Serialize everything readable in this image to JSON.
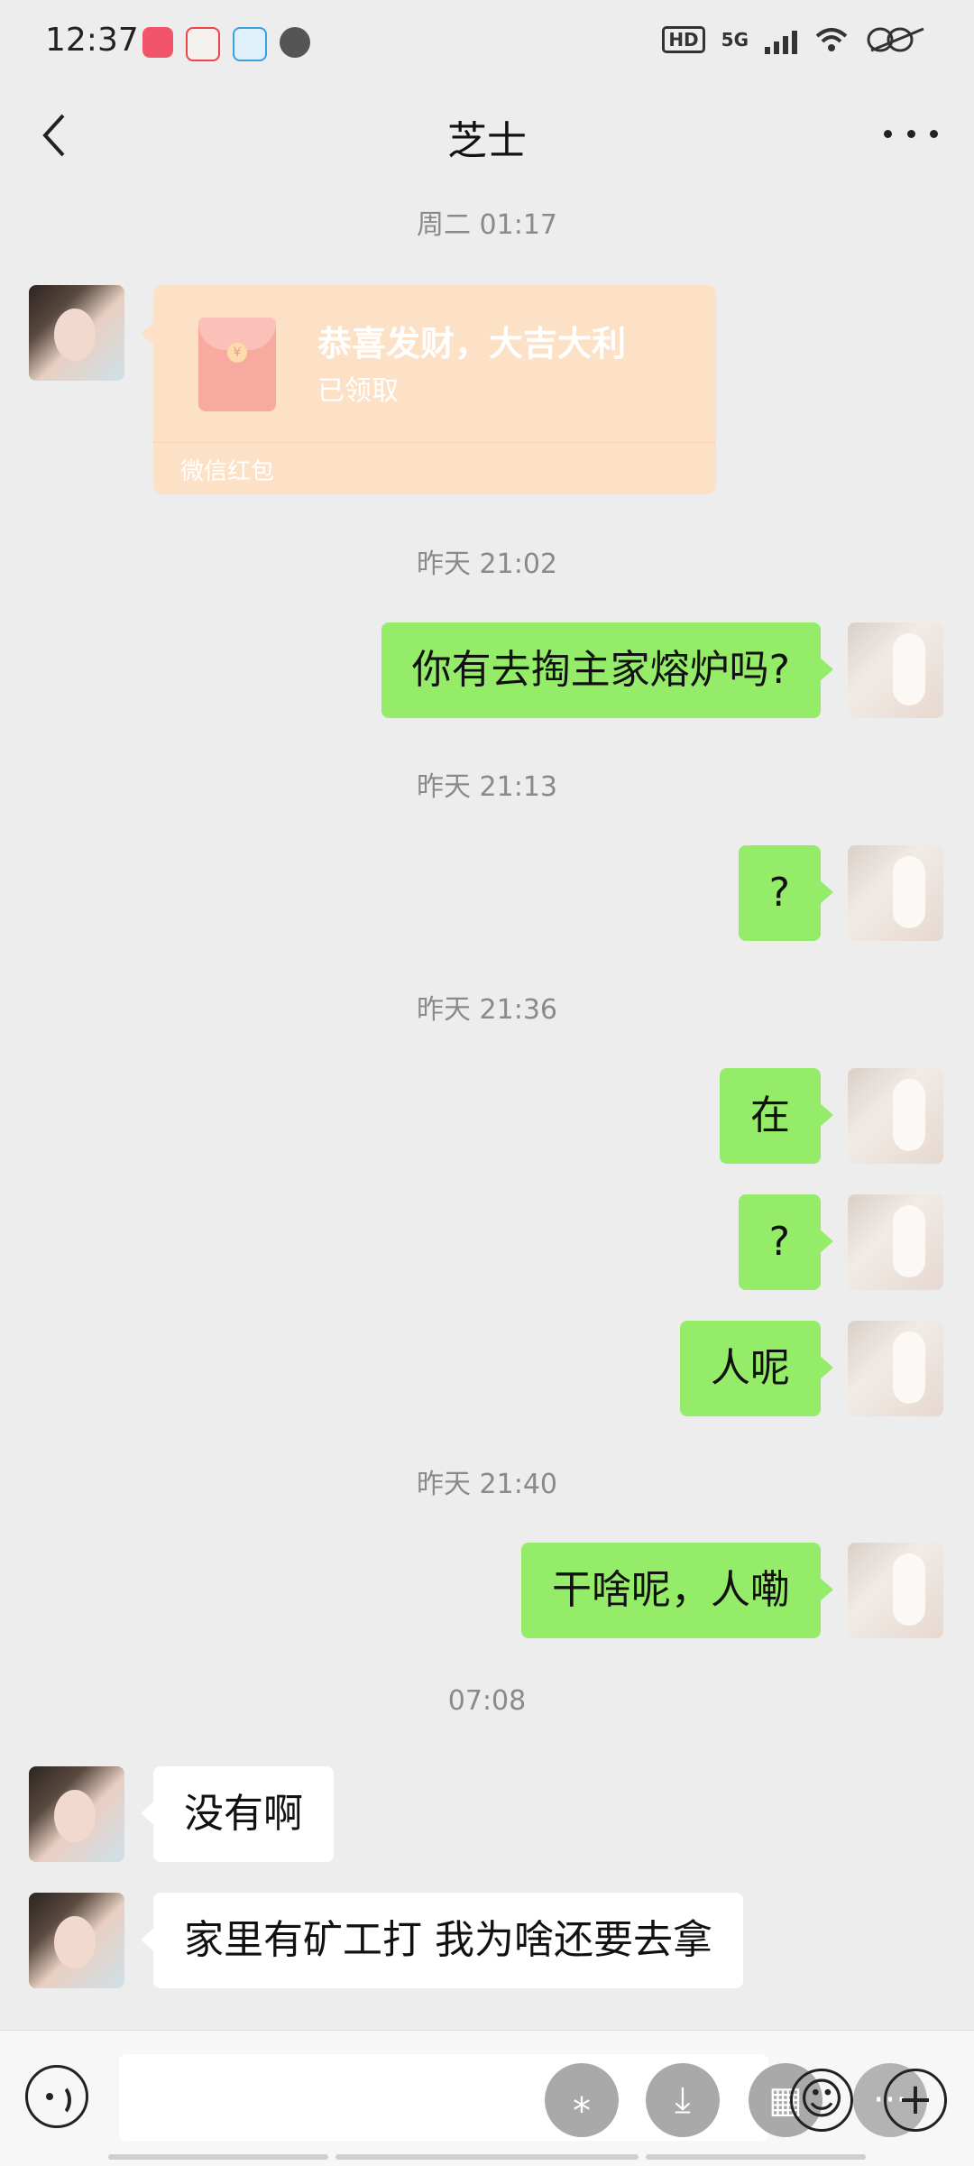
{
  "status_bar": {
    "time": "12:37",
    "network": "5G",
    "hd": "HD"
  },
  "header": {
    "title": "芝士"
  },
  "red_packet": {
    "title": "恭喜发财，大吉大利",
    "status": "已领取",
    "footer": "微信红包",
    "coin": "¥"
  },
  "messages": {
    "ts1": "周二 01:17",
    "ts2": "昨天 21:02",
    "m1": "你有去掏主家熔炉吗?",
    "ts3": "昨天 21:13",
    "m2": "?",
    "ts4": "昨天 21:36",
    "m3": "在",
    "m4": "?",
    "m5": "人呢",
    "ts5": "昨天 21:40",
    "m6": "干啥呢，人嘞",
    "ts6": "07:08",
    "r1": "没有啊",
    "r2": "家里有矿工打 我为啥还要去拿"
  },
  "input_bar": {
    "btn_star": "⁎",
    "btn_download": "⤓",
    "btn_grid": "▦",
    "btn_emoji": "☺",
    "btn_more": "···",
    "btn_plus": "+"
  },
  "colors": {
    "background": "#ededed",
    "my_bubble": "#95ec69",
    "their_bubble": "#ffffff",
    "red_packet": "#fde1c6"
  }
}
